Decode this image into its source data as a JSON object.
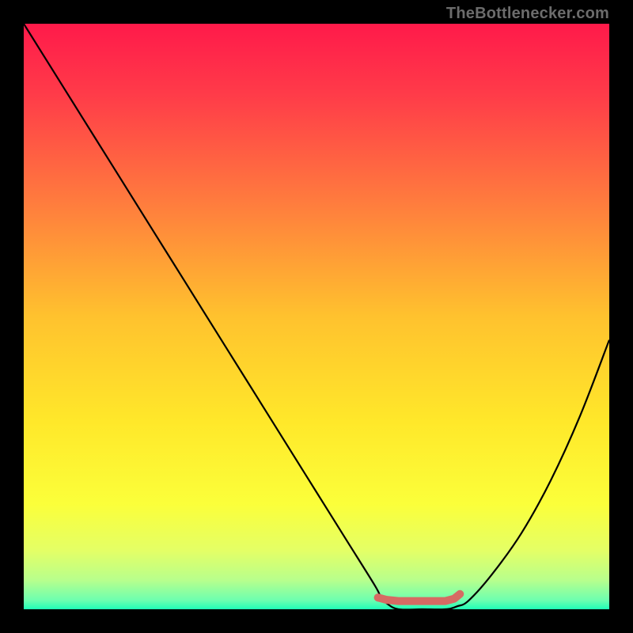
{
  "watermark": "TheBottlenecker.com",
  "chart_data": {
    "type": "line",
    "title": "",
    "xlabel": "",
    "ylabel": "",
    "xlim": [
      0,
      100
    ],
    "ylim": [
      0,
      100
    ],
    "gradient_stops": [
      {
        "offset": 0,
        "color": "#ff1a4a"
      },
      {
        "offset": 0.12,
        "color": "#ff3b49"
      },
      {
        "offset": 0.3,
        "color": "#ff7a3e"
      },
      {
        "offset": 0.5,
        "color": "#ffc22e"
      },
      {
        "offset": 0.68,
        "color": "#ffe82a"
      },
      {
        "offset": 0.82,
        "color": "#fbff3a"
      },
      {
        "offset": 0.9,
        "color": "#e4ff66"
      },
      {
        "offset": 0.95,
        "color": "#b8ff8c"
      },
      {
        "offset": 0.985,
        "color": "#6cffb0"
      },
      {
        "offset": 1.0,
        "color": "#1fffb7"
      }
    ],
    "series": [
      {
        "name": "bottleneck-curve",
        "x": [
          0,
          5,
          10,
          15,
          20,
          25,
          30,
          35,
          40,
          45,
          50,
          55,
          60,
          61,
          62,
          64,
          68,
          72,
          74,
          76,
          80,
          85,
          90,
          95,
          100
        ],
        "values": [
          100,
          92,
          84,
          76,
          68,
          60,
          52,
          44,
          36,
          28,
          20,
          12,
          4,
          2,
          1,
          0,
          0,
          0,
          0.5,
          1.5,
          6,
          13,
          22,
          33,
          46
        ]
      }
    ],
    "marker": {
      "name": "flat-segment-marker",
      "color": "#d66a63",
      "points_x": [
        60.5,
        62,
        64,
        66,
        68,
        70,
        72,
        73.5,
        74.5
      ],
      "points_y": [
        2.0,
        1.6,
        1.4,
        1.4,
        1.4,
        1.4,
        1.4,
        1.8,
        2.6
      ],
      "dot": {
        "x": 60.5,
        "y": 2.0,
        "r": 5
      }
    }
  }
}
